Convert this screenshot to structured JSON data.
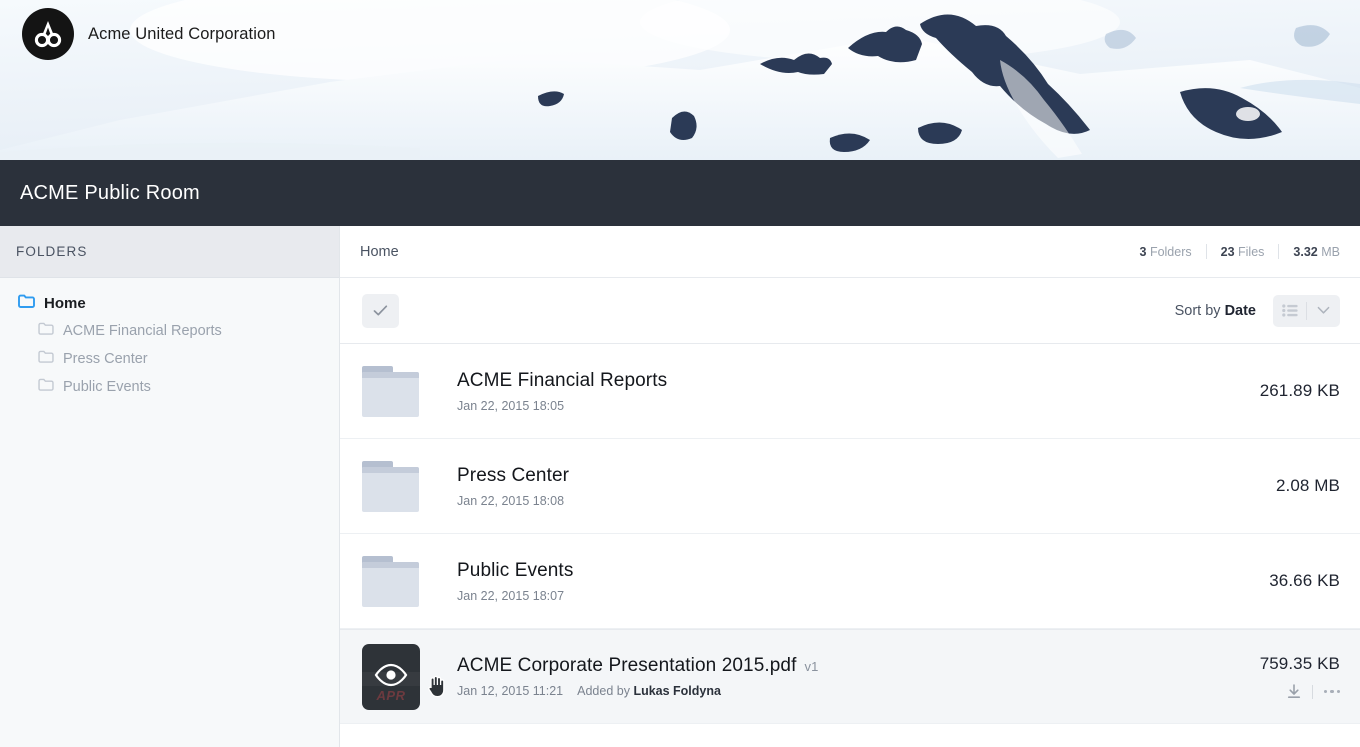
{
  "brand": {
    "name": "Acme United Corporation",
    "logo_icon": "acme-circle-logo"
  },
  "banner": {
    "image_alt": "snowy-mountain-banner",
    "sky_color": "#eef4fa",
    "rock_color": "#2b3a56"
  },
  "room": {
    "title": "ACME Public Room",
    "bar_color": "#2b313b"
  },
  "sidebar": {
    "header": "FOLDERS",
    "items": [
      {
        "label": "Home",
        "icon": "folder-icon",
        "active": true,
        "level": 0
      },
      {
        "label": "ACME Financial Reports",
        "icon": "folder-icon",
        "active": false,
        "level": 1
      },
      {
        "label": "Press Center",
        "icon": "folder-icon",
        "active": false,
        "level": 1
      },
      {
        "label": "Public Events",
        "icon": "folder-icon",
        "active": false,
        "level": 1
      }
    ]
  },
  "breadcrumb": {
    "path": "Home",
    "stats": {
      "folders_count": "3",
      "folders_label": "Folders",
      "files_count": "23",
      "files_label": "Files",
      "size_value": "3.32",
      "size_unit": "MB"
    }
  },
  "toolbar": {
    "select_all_icon": "check-icon",
    "sort_prefix": "Sort by",
    "sort_value": "Date",
    "list_view_icon": "list-view-icon",
    "chevron_icon": "chevron-down-icon"
  },
  "files": [
    {
      "name": "ACME Financial Reports",
      "type": "folder",
      "icon": "folder-icon",
      "date": "Jan 22, 2015 18:05",
      "size": "261.89 KB",
      "version": "",
      "added_by_prefix": "",
      "added_by": "",
      "hover": false
    },
    {
      "name": "Press Center",
      "type": "folder",
      "icon": "folder-icon",
      "date": "Jan 22, 2015 18:08",
      "size": "2.08 MB",
      "version": "",
      "added_by_prefix": "",
      "added_by": "",
      "hover": false
    },
    {
      "name": "Public Events",
      "type": "folder",
      "icon": "folder-icon",
      "date": "Jan 22, 2015 18:07",
      "size": "36.66 KB",
      "version": "",
      "added_by_prefix": "",
      "added_by": "",
      "hover": false
    },
    {
      "name": "ACME Corporate Presentation 2015.pdf",
      "type": "pdf",
      "icon": "eye-preview-icon",
      "thumb_text": "APR",
      "date": "Jan 12, 2015 11:21",
      "size": "759.35 KB",
      "version": "v1",
      "added_by_prefix": "Added by",
      "added_by": "Lukas Foldyna",
      "hover": true,
      "download_icon": "download-icon",
      "more_icon": "more-options-icon"
    }
  ]
}
